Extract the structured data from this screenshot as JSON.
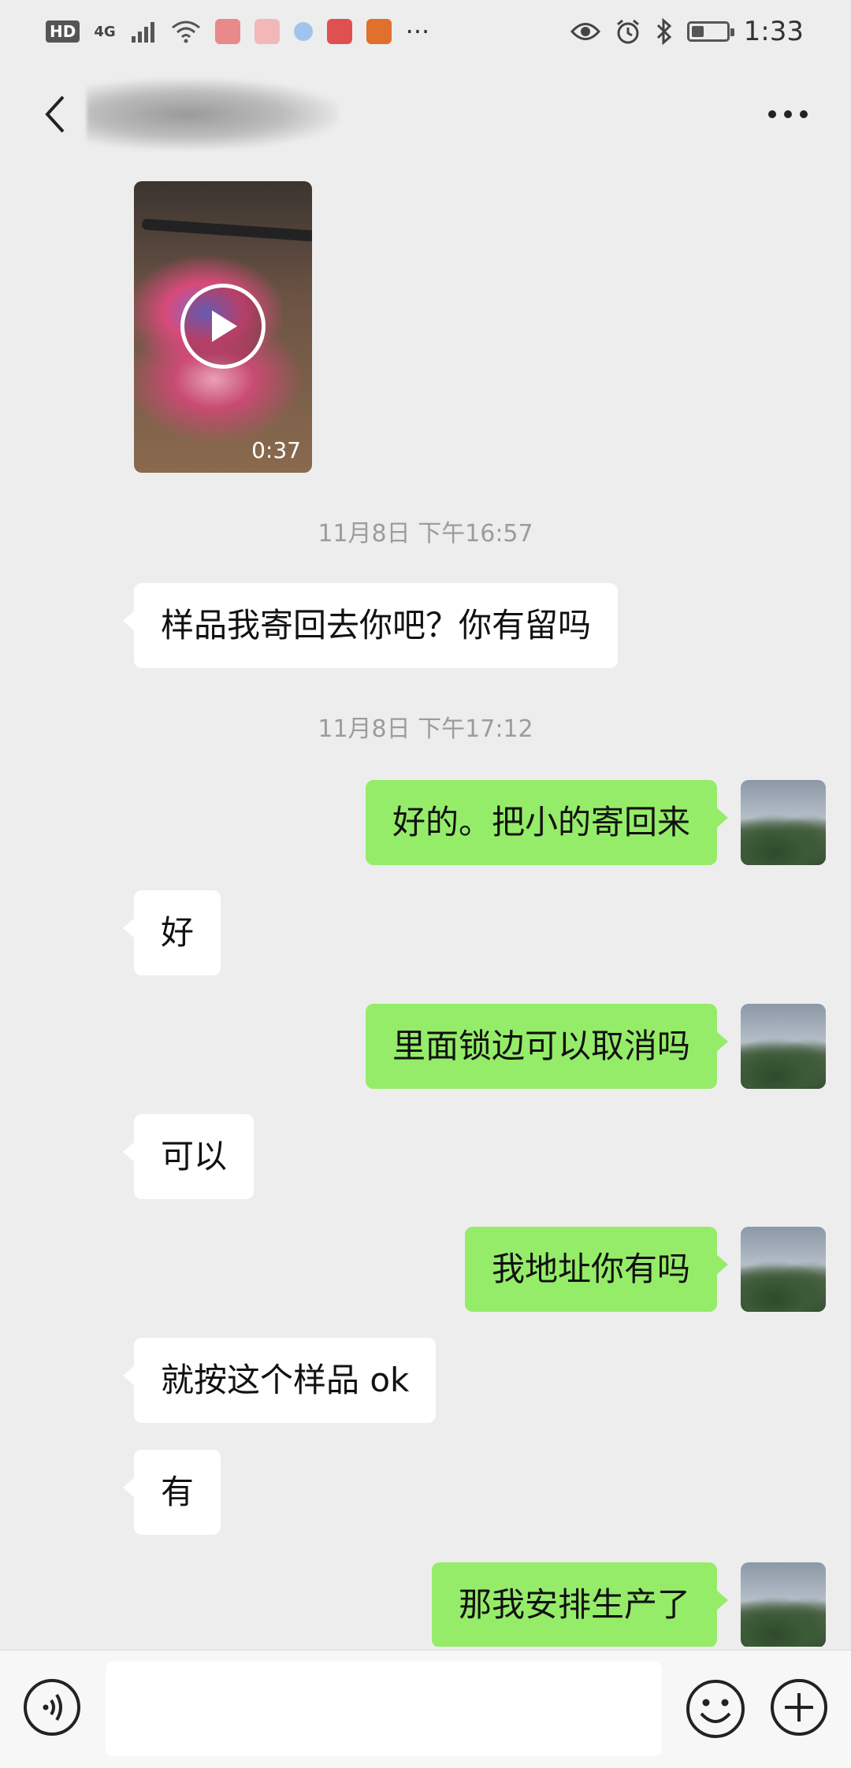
{
  "status_bar": {
    "hd": "HD",
    "network": "4G",
    "dots": "···",
    "time": "1:33",
    "battery_level": 0.35,
    "icons": [
      "signal-icon",
      "wifi-icon",
      "eye-icon",
      "alarm-icon",
      "bluetooth-icon",
      "battery-icon"
    ]
  },
  "header": {
    "back_icon": "chevron-left-icon",
    "more_icon": "ellipsis-icon"
  },
  "video": {
    "duration": "0:37",
    "play_icon": "play-icon"
  },
  "timestamps": [
    "11月8日 下午16:57",
    "11月8日 下午17:12"
  ],
  "messages": [
    {
      "side": "in",
      "text": "样品我寄回去你吧？你有留吗"
    },
    {
      "side": "out",
      "text": "好的。把小的寄回来"
    },
    {
      "side": "in",
      "text": "好"
    },
    {
      "side": "out",
      "text": "里面锁边可以取消吗"
    },
    {
      "side": "in",
      "text": "可以"
    },
    {
      "side": "out",
      "text": "我地址你有吗"
    },
    {
      "side": "in",
      "text": "就按这个样品 ok"
    },
    {
      "side": "in",
      "text": "有"
    },
    {
      "side": "out",
      "text": "那我安排生产了"
    }
  ],
  "input_bar": {
    "voice_icon": "voice-icon",
    "emoji_icon": "emoji-icon",
    "plus_icon": "plus-icon",
    "input_value": ""
  },
  "colors": {
    "background": "#ededed",
    "incoming_bubble": "#ffffff",
    "outgoing_bubble": "#95ec69",
    "timestamp": "#9c9c9c"
  }
}
